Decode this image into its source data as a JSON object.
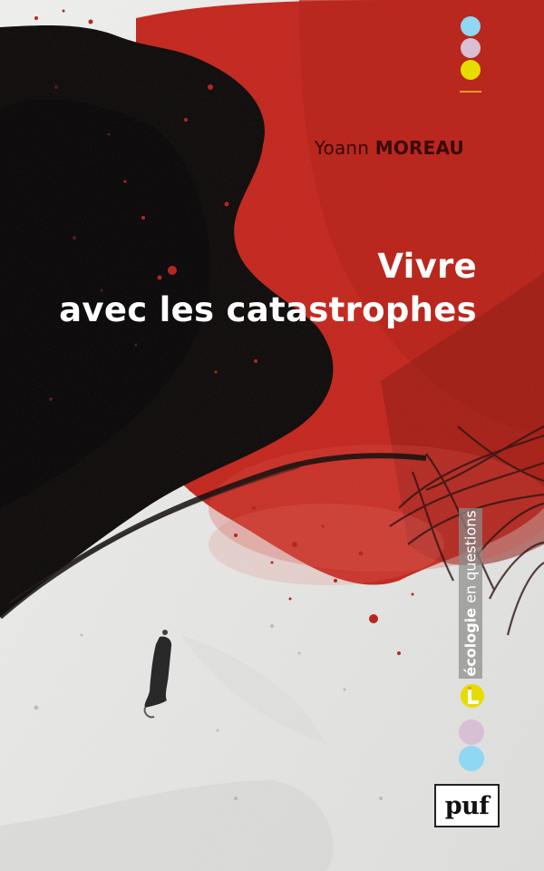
{
  "book": {
    "author_first": "Yoann",
    "author_last": "MOREAU",
    "title_line1": "Vivre",
    "title_line2": "avec les catastrophes"
  },
  "series": {
    "name_bold": "écologie",
    "name_rest": " en questions"
  },
  "publisher": {
    "name": "puf"
  },
  "colors": {
    "background_light": "#e9e9e7",
    "black_mass": "#0b0807",
    "red_spray": "#c3241b",
    "dark_red": "#8e1710",
    "author_text": "#3a0907",
    "title_text": "#ffffff",
    "dot_light_blue": "#8fd7f2",
    "dot_pink": "#d9bfd3",
    "dot_yellow": "#e6dd00",
    "accent_orange": "#f39c1e",
    "series_band": "#8c8c8c"
  },
  "icons": {
    "series_logo": "series-l-logo-icon",
    "publisher_logo": "puf-logo"
  }
}
